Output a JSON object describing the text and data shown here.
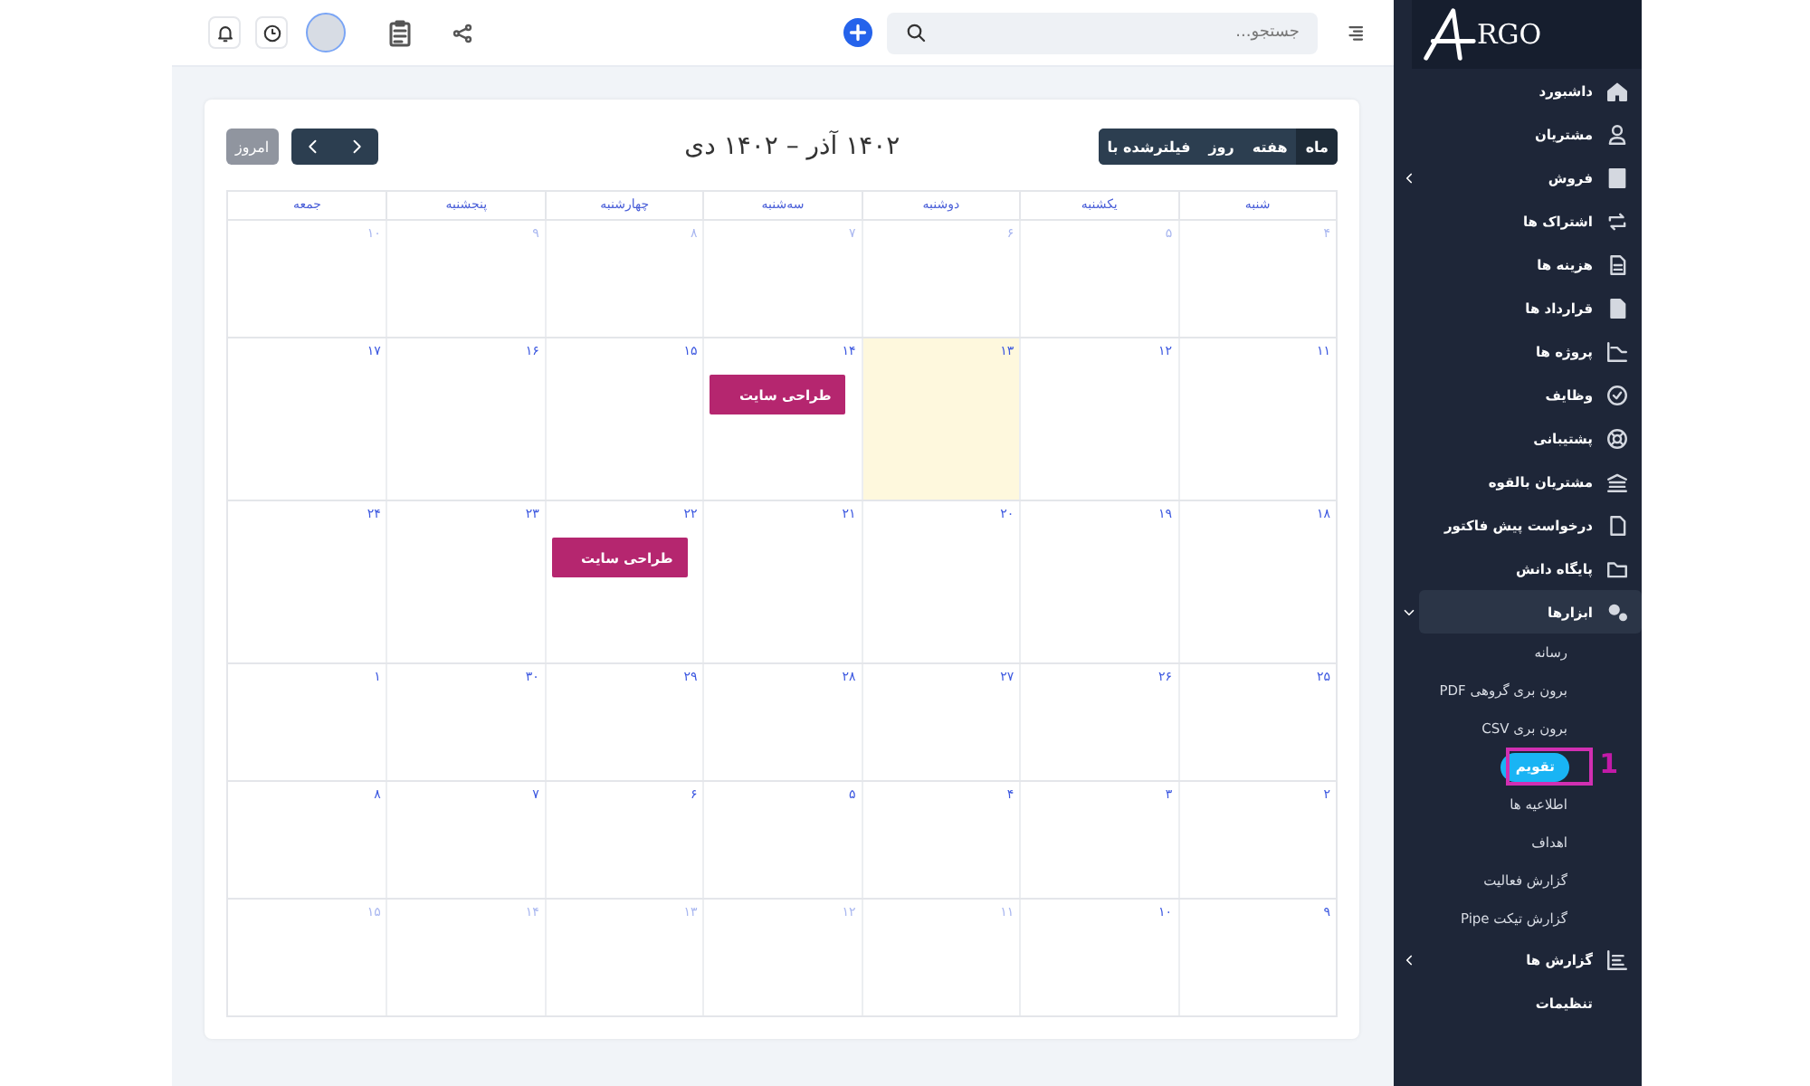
{
  "header": {
    "search": {
      "placeholder": "جستجو..."
    }
  },
  "calendar": {
    "title": "۱۴۰۲ آذر – ۱۴۰۲ دی",
    "views": [
      {
        "label": "ماه",
        "selected": true
      },
      {
        "label": "هفته",
        "selected": false
      },
      {
        "label": "روز",
        "selected": false
      },
      {
        "label": "فیلترشده با",
        "selected": false
      }
    ],
    "today_button": {
      "label": "امروز",
      "disabled": true
    },
    "weekdays": [
      "شنبه",
      "یکشنبه",
      "دوشنبه",
      "سه‌شنبه",
      "چهارشنبه",
      "پنجشنبه",
      "جمعه"
    ],
    "weeks": [
      [
        {
          "day": "۴",
          "muted": true
        },
        {
          "day": "۵",
          "muted": true
        },
        {
          "day": "۶",
          "muted": true
        },
        {
          "day": "۷",
          "muted": true
        },
        {
          "day": "۸",
          "muted": true
        },
        {
          "day": "۹",
          "muted": true
        },
        {
          "day": "۱۰",
          "muted": true
        }
      ],
      [
        {
          "day": "۱۱",
          "muted": false
        },
        {
          "day": "۱۲",
          "muted": false
        },
        {
          "day": "۱۳",
          "muted": false,
          "today": true
        },
        {
          "day": "۱۴",
          "muted": false,
          "events": [
            {
              "title": "طراحی سایت",
              "color": "#b5266f"
            }
          ]
        },
        {
          "day": "۱۵",
          "muted": false
        },
        {
          "day": "۱۶",
          "muted": false
        },
        {
          "day": "۱۷",
          "muted": false
        }
      ],
      [
        {
          "day": "۱۸",
          "muted": false
        },
        {
          "day": "۱۹",
          "muted": false
        },
        {
          "day": "۲۰",
          "muted": false
        },
        {
          "day": "۲۱",
          "muted": false
        },
        {
          "day": "۲۲",
          "muted": false,
          "events": [
            {
              "title": "طراحی سایت",
              "color": "#b5266f"
            }
          ]
        },
        {
          "day": "۲۳",
          "muted": false
        },
        {
          "day": "۲۴",
          "muted": false
        }
      ],
      [
        {
          "day": "۲۵",
          "muted": false
        },
        {
          "day": "۲۶",
          "muted": false
        },
        {
          "day": "۲۷",
          "muted": false
        },
        {
          "day": "۲۸",
          "muted": false
        },
        {
          "day": "۲۹",
          "muted": false
        },
        {
          "day": "۳۰",
          "muted": false
        },
        {
          "day": "۱",
          "muted": false
        }
      ],
      [
        {
          "day": "۲",
          "muted": false
        },
        {
          "day": "۳",
          "muted": false
        },
        {
          "day": "۴",
          "muted": false
        },
        {
          "day": "۵",
          "muted": false
        },
        {
          "day": "۶",
          "muted": false
        },
        {
          "day": "۷",
          "muted": false
        },
        {
          "day": "۸",
          "muted": false
        }
      ],
      [
        {
          "day": "۹",
          "muted": false
        },
        {
          "day": "۱۰",
          "muted": false
        },
        {
          "day": "۱۱",
          "muted": true
        },
        {
          "day": "۱۲",
          "muted": true
        },
        {
          "day": "۱۳",
          "muted": true
        },
        {
          "day": "۱۴",
          "muted": true
        },
        {
          "day": "۱۵",
          "muted": true
        }
      ]
    ]
  },
  "sidebar": {
    "logo": "RGO",
    "items": [
      {
        "label": "داشبورد",
        "has_submenu": false
      },
      {
        "label": "مشتریان",
        "has_submenu": false
      },
      {
        "label": "فروش",
        "has_submenu": true,
        "expanded": false
      },
      {
        "label": "اشتراک ها",
        "has_submenu": false
      },
      {
        "label": "هزینه ها",
        "has_submenu": false
      },
      {
        "label": "قرارداد ها",
        "has_submenu": false
      },
      {
        "label": "پروژه ها",
        "has_submenu": false
      },
      {
        "label": "وظایف",
        "has_submenu": false
      },
      {
        "label": "پشتیبانی",
        "has_submenu": false
      },
      {
        "label": "مشتریان بالقوه",
        "has_submenu": false
      },
      {
        "label": "درخواست پیش فاکتور",
        "has_submenu": false
      },
      {
        "label": "پایگاه دانش",
        "has_submenu": false
      },
      {
        "label": "ابزارها",
        "has_submenu": true,
        "expanded": true,
        "children": [
          {
            "label": "رسانه",
            "selected": false
          },
          {
            "label": "برون بری گروهی PDF",
            "selected": false
          },
          {
            "label": "برون بری CSV",
            "selected": false
          },
          {
            "label": "تقویم",
            "selected": true
          },
          {
            "label": "اطلاعیه ها",
            "selected": false
          },
          {
            "label": "اهداف",
            "selected": false
          },
          {
            "label": "گزارش فعالیت",
            "selected": false
          },
          {
            "label": "گزارش تیکت Pipe",
            "selected": false
          }
        ]
      },
      {
        "label": "گزارش ها",
        "has_submenu": true,
        "expanded": false
      },
      {
        "label": "تنظیمات",
        "has_submenu": false
      }
    ]
  },
  "annotation": {
    "label": "1"
  }
}
